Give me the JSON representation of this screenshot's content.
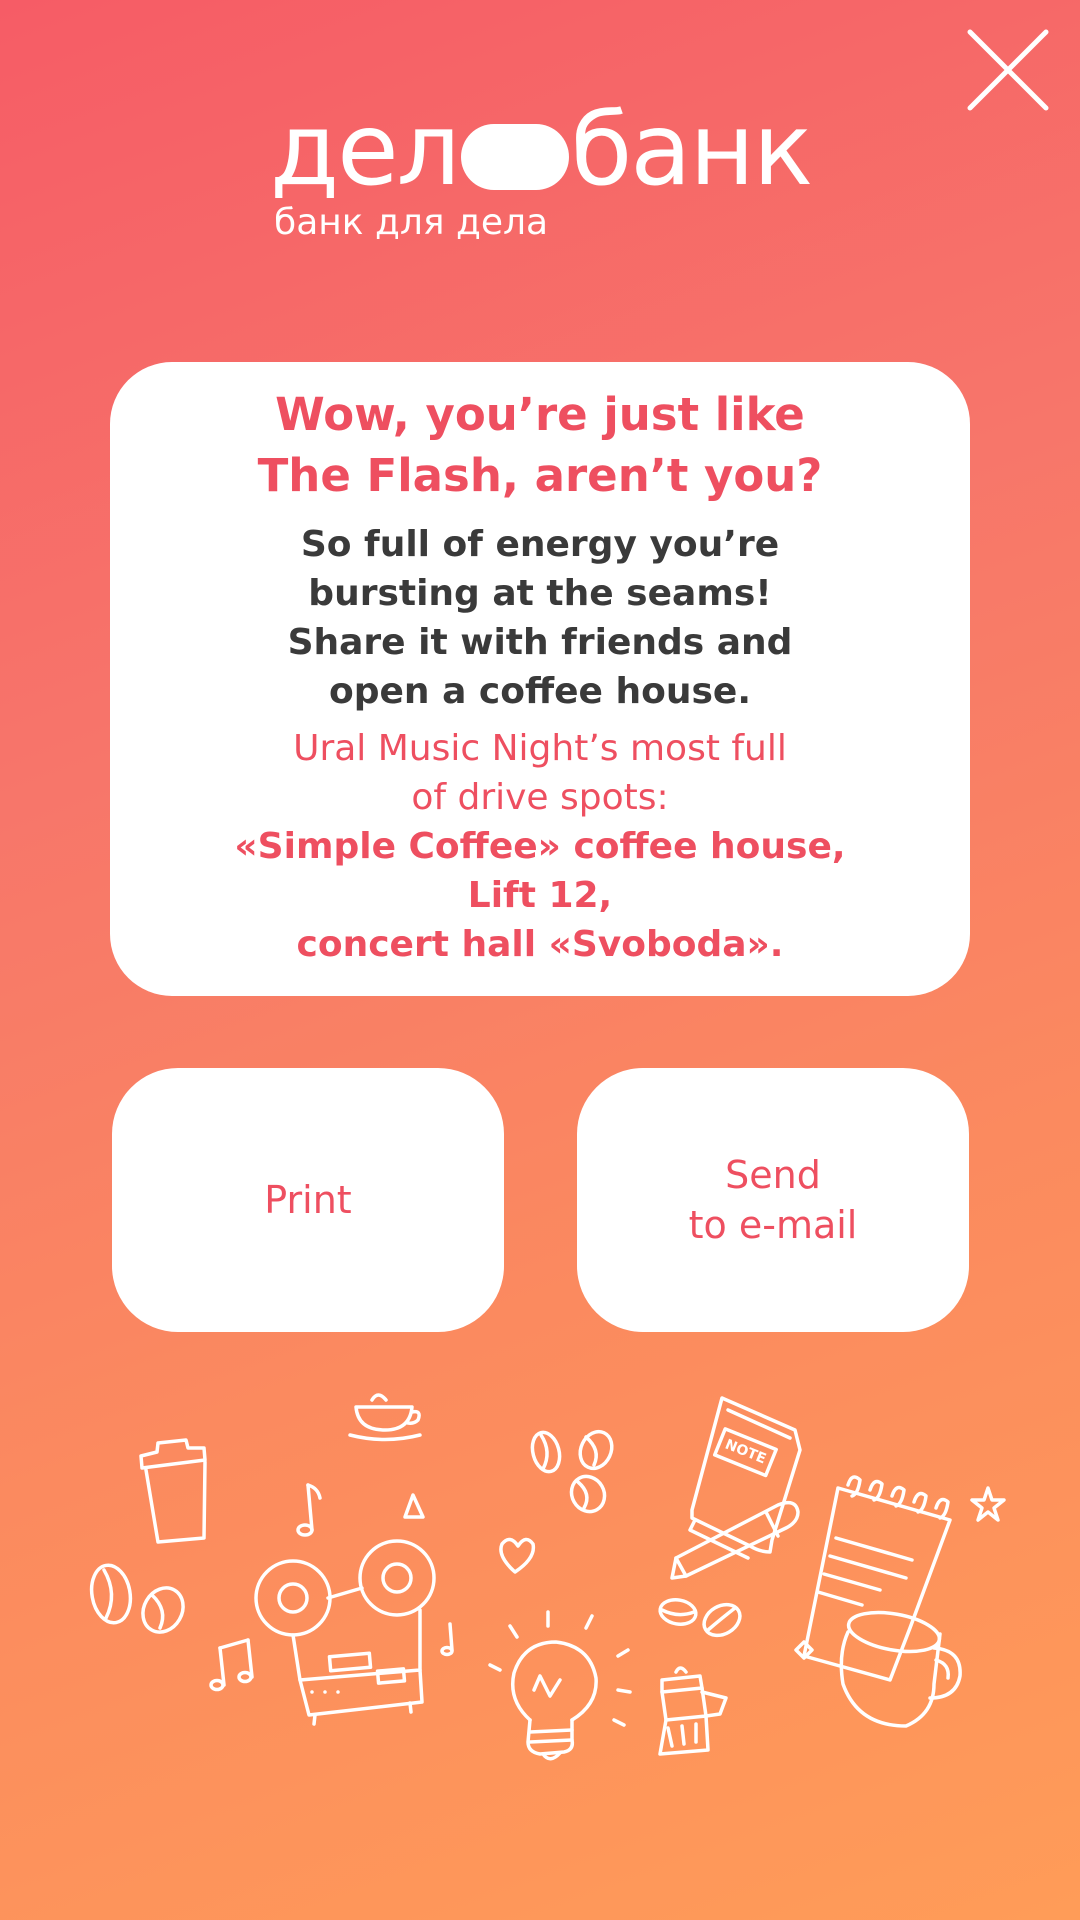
{
  "header": {
    "close_icon": "close-icon",
    "logo": {
      "word_left": "дел",
      "word_right": "банк",
      "tagline": "банк для дела"
    }
  },
  "card": {
    "headline": [
      "Wow, you’re just like",
      "The Flash, aren’t you?"
    ],
    "body": [
      "So full of energy you’re",
      "bursting at the seams!",
      "Share it with friends and",
      "open a coffee house."
    ],
    "spots_intro": [
      "Ural Music Night’s most full",
      "of drive spots:"
    ],
    "spots": [
      "«Simple Coffee» coffee house,",
      "Lift 12,",
      "concert hall «Svoboda»."
    ]
  },
  "actions": {
    "print_label": "Print",
    "email_label": [
      "Send",
      "to e-mail"
    ]
  },
  "illustration": {
    "icons": [
      "coffee-cup-icon",
      "to-go-cup-icon",
      "music-note-icon",
      "coffee-bean-icon",
      "tape-recorder-icon",
      "light-bulb-icon",
      "heart-icon",
      "notebook-icon",
      "pencil-icon",
      "notepad-icon",
      "mug-icon",
      "moka-pot-icon",
      "star-icon"
    ],
    "notebook_label": "NOTE"
  },
  "colors": {
    "accent": "#ee4f60",
    "body_text": "#3a3a3a",
    "gradient_top": "#f65c66",
    "gradient_bottom": "#ff9c58",
    "card": "#ffffff"
  }
}
